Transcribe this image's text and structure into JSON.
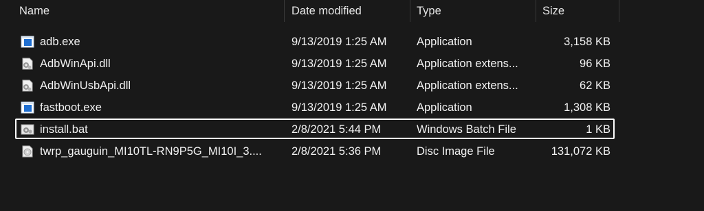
{
  "columns": {
    "name": "Name",
    "date": "Date modified",
    "type": "Type",
    "size": "Size"
  },
  "files": [
    {
      "name": "adb.exe",
      "date": "9/13/2019 1:25 AM",
      "type": "Application",
      "size": "3,158 KB",
      "icon": "application-icon"
    },
    {
      "name": "AdbWinApi.dll",
      "date": "9/13/2019 1:25 AM",
      "type": "Application extens...",
      "size": "96 KB",
      "icon": "dll-gear-icon"
    },
    {
      "name": "AdbWinUsbApi.dll",
      "date": "9/13/2019 1:25 AM",
      "type": "Application extens...",
      "size": "62 KB",
      "icon": "dll-gear-icon"
    },
    {
      "name": "fastboot.exe",
      "date": "9/13/2019 1:25 AM",
      "type": "Application",
      "size": "1,308 KB",
      "icon": "application-icon"
    },
    {
      "name": "install.bat",
      "date": "2/8/2021 5:44 PM",
      "type": "Windows Batch File",
      "size": "1 KB",
      "icon": "batch-gear-icon",
      "highlighted": true
    },
    {
      "name": "twrp_gauguin_MI10TL-RN9P5G_MI10I_3....",
      "date": "2/8/2021 5:36 PM",
      "type": "Disc Image File",
      "size": "131,072 KB",
      "icon": "disc-image-icon"
    }
  ]
}
